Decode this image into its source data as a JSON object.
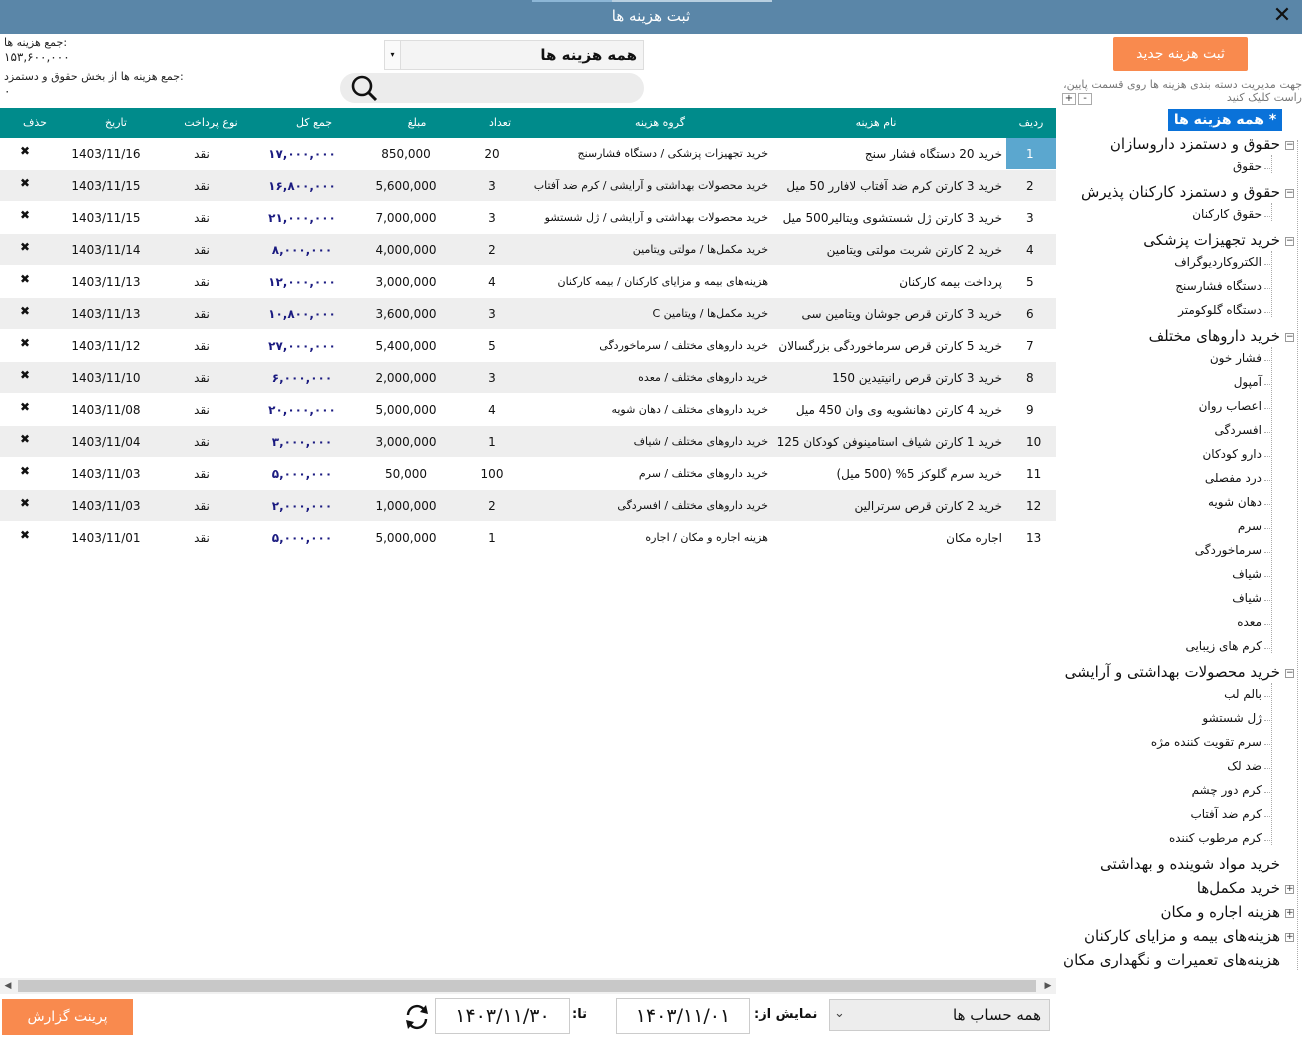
{
  "window": {
    "title": "ثبت هزینه ها",
    "close": "✕"
  },
  "summary": {
    "total_label": "جمع هزینه ها:",
    "total_value": "۱۵۳,۶۰۰,۰۰۰",
    "payroll_label": "جمع هزینه ها از بخش حقوق و دستمزد:",
    "payroll_value": "۰"
  },
  "filter": {
    "selected": "همه هزینه ها",
    "arrow": "▾"
  },
  "search": {
    "placeholder": "",
    "value": ""
  },
  "grid": {
    "headers": {
      "idx": "ردیف",
      "name": "نام هزینه",
      "group": "گروه هزینه",
      "count": "تعداد",
      "amount": "مبلغ",
      "total": "جمع کل",
      "pay": "نوع پرداخت",
      "date": "تاریخ",
      "del": "حذف"
    },
    "rows": [
      {
        "idx": "1",
        "name": "خرید 20 دستگاه فشار سنج",
        "group": "خرید تجهیزات پزشکی / دستگاه فشارسنج",
        "count": "20",
        "amount": "850,000",
        "total": "۱۷,۰۰۰,۰۰۰",
        "pay": "نقد",
        "date": "1403/11/16"
      },
      {
        "idx": "2",
        "name": "خرید 3 کارتن کرم ضد آفتاب لافارر 50 میل",
        "group": "خرید محصولات بهداشتی و آرایشی / کرم ضد آفتاب",
        "count": "3",
        "amount": "5,600,000",
        "total": "۱۶,۸۰۰,۰۰۰",
        "pay": "نقد",
        "date": "1403/11/15"
      },
      {
        "idx": "3",
        "name": "خرید 3 کارتن ژل شستشوی ویتالیر500 میل",
        "group": "خرید محصولات بهداشتی و آرایشی / ژل شستشو",
        "count": "3",
        "amount": "7,000,000",
        "total": "۲۱,۰۰۰,۰۰۰",
        "pay": "نقد",
        "date": "1403/11/15"
      },
      {
        "idx": "4",
        "name": "خرید 2 کارتن شربت مولتی ویتامین",
        "group": "خرید مکمل‌ها / مولتی ویتامین",
        "count": "2",
        "amount": "4,000,000",
        "total": "۸,۰۰۰,۰۰۰",
        "pay": "نقد",
        "date": "1403/11/14"
      },
      {
        "idx": "5",
        "name": "پرداخت بیمه کارکنان",
        "group": "هزینه‌های بیمه و مزایای کارکنان / بیمه کارکنان",
        "count": "4",
        "amount": "3,000,000",
        "total": "۱۲,۰۰۰,۰۰۰",
        "pay": "نقد",
        "date": "1403/11/13"
      },
      {
        "idx": "6",
        "name": "خرید 3 کارتن قرص جوشان ویتامین سی",
        "group": "خرید مکمل‌ها / ویتامین C",
        "count": "3",
        "amount": "3,600,000",
        "total": "۱۰,۸۰۰,۰۰۰",
        "pay": "نقد",
        "date": "1403/11/13"
      },
      {
        "idx": "7",
        "name": "خرید 5 کارتن قرص سرماخوردگی بزرگسالان",
        "group": "خرید داروهای مختلف / سرماخوردگی",
        "count": "5",
        "amount": "5,400,000",
        "total": "۲۷,۰۰۰,۰۰۰",
        "pay": "نقد",
        "date": "1403/11/12"
      },
      {
        "idx": "8",
        "name": "خرید 3 کارتن قرص رانیتیدین 150",
        "group": "خرید داروهای مختلف / معده",
        "count": "3",
        "amount": "2,000,000",
        "total": "۶,۰۰۰,۰۰۰",
        "pay": "نقد",
        "date": "1403/11/10"
      },
      {
        "idx": "9",
        "name": "خرید 4 کارتن دهانشویه وی وان 450 میل",
        "group": "خرید داروهای مختلف / دهان شویه",
        "count": "4",
        "amount": "5,000,000",
        "total": "۲۰,۰۰۰,۰۰۰",
        "pay": "نقد",
        "date": "1403/11/08"
      },
      {
        "idx": "10",
        "name": "خرید 1 کارتن شیاف استامینوفن کودکان 125",
        "group": "خرید داروهای مختلف / شیاف",
        "count": "1",
        "amount": "3,000,000",
        "total": "۳,۰۰۰,۰۰۰",
        "pay": "نقد",
        "date": "1403/11/04"
      },
      {
        "idx": "11",
        "name": "خرید سرم گلوکز 5% (500 میل)",
        "group": "خرید داروهای مختلف / سرم",
        "count": "100",
        "amount": "50,000",
        "total": "۵,۰۰۰,۰۰۰",
        "pay": "نقد",
        "date": "1403/11/03"
      },
      {
        "idx": "12",
        "name": "خرید 2 کارتن قرص سرترالین",
        "group": "خرید داروهای مختلف / افسردگی",
        "count": "2",
        "amount": "1,000,000",
        "total": "۲,۰۰۰,۰۰۰",
        "pay": "نقد",
        "date": "1403/11/03"
      },
      {
        "idx": "13",
        "name": "اجاره مکان",
        "group": "هزینه اجاره و مکان / اجاره",
        "count": "1",
        "amount": "5,000,000",
        "total": "۵,۰۰۰,۰۰۰",
        "pay": "نقد",
        "date": "1403/11/01"
      }
    ]
  },
  "sidebar": {
    "new_button": "ثبت هزینه جدید",
    "help": "جهت مدیریت دسته بندی هزینه ها روی قسمت پایین، راست کلیک کنید",
    "plus": "+",
    "minus": "-",
    "tree_root": "* همه هزینه ها *",
    "nodes": [
      {
        "label": "حقوق و دستمزد داروسازان",
        "expanded": true,
        "children": [
          "حقوق"
        ]
      },
      {
        "label": "حقوق و دستمزد کارکنان پذیرش",
        "expanded": true,
        "children": [
          "حقوق کارکنان"
        ]
      },
      {
        "label": "خرید تجهیزات پزشکی",
        "expanded": true,
        "children": [
          "الکتروکاردیوگراف",
          "دستگاه فشارسنج",
          "دستگاه گلوکومتر"
        ]
      },
      {
        "label": "خرید داروهای مختلف",
        "expanded": true,
        "children": [
          "فشار خون",
          "آمپول",
          "اعصاب روان",
          "افسردگی",
          "دارو کودکان",
          "درد مفصلی",
          "دهان شویه",
          "سرم",
          "سرماخوردگی",
          "شیاف",
          "شیاف",
          "معده",
          "کرم های زیبایی"
        ]
      },
      {
        "label": "خرید محصولات بهداشتی و آرایشی",
        "expanded": true,
        "children": [
          "بالم لب",
          "ژل شستشو",
          "سرم تقویت کننده مژه",
          "ضد لک",
          "کرم دور چشم",
          "کرم ضد آفتاب",
          "کرم مرطوب کننده"
        ]
      },
      {
        "label": "خرید مواد شوینده و بهداشتی",
        "expanded": false,
        "leafless": true,
        "children": []
      },
      {
        "label": "خرید مکمل‌ها",
        "expanded": false,
        "children": []
      },
      {
        "label": "هزینه اجاره و مکان",
        "expanded": false,
        "children": []
      },
      {
        "label": "هزینه‌های بیمه و مزایای کارکنان",
        "expanded": false,
        "children": []
      },
      {
        "label": "هزینه‌های تعمیرات و نگهداری مکان",
        "expanded": false,
        "leafless": true,
        "children": []
      }
    ]
  },
  "footer": {
    "print_button": "پرینت گزارش",
    "to_label": "تا:",
    "to_date": "۱۴۰۳/۱۱/۳۰",
    "from_label": "نمایش از:",
    "from_date": "۱۴۰۳/۱۱/۰۱",
    "account_selected": "همه حساب ها",
    "account_arrow": "⌄"
  },
  "colors": {
    "header_bg": "#008b8b",
    "title_bg": "#5a86a8",
    "accent_orange": "#f98a4e",
    "selection_blue": "#0a72d9",
    "row_alt": "#eeeeee",
    "index_highlight": "#5ba7cf"
  }
}
